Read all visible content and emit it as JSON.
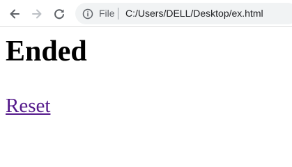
{
  "browser": {
    "back_icon": "arrow-left-icon",
    "forward_icon": "arrow-right-icon",
    "reload_icon": "reload-icon",
    "info_icon": "info-icon",
    "scheme_label": "File",
    "url": "C:/Users/DELL/Desktop/ex.html",
    "colors": {
      "omnibox_bg": "#f1f3f4",
      "icon_active": "#5f6368",
      "icon_disabled": "#bdc1c6"
    }
  },
  "page": {
    "heading": "Ended",
    "link_label": "Reset",
    "colors": {
      "link_visited": "#551a8b"
    }
  }
}
